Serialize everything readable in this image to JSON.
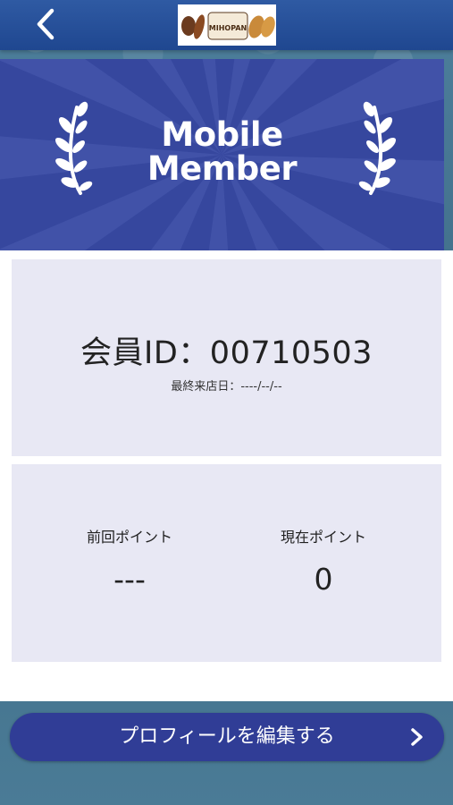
{
  "header": {
    "back_icon": "chevron-left-icon",
    "logo_icon": "store-logo-icon",
    "logo_text": "MIHOPAN"
  },
  "banner": {
    "title_line1": "Mobile",
    "title_line2": "Member",
    "decoration_icon": "laurel-icon"
  },
  "member": {
    "id_text": "会員ID：00710503",
    "last_visit": "最終来店日：----/--/--"
  },
  "points": {
    "previous_label": "前回ポイント",
    "previous_value": "---",
    "current_label": "現在ポイント",
    "current_value": "0"
  },
  "actions": {
    "edit_profile_label": "プロフィールを編集する",
    "edit_profile_icon": "chevron-right-icon"
  },
  "colors": {
    "header": "#2f5aa3",
    "banner": "#36479e",
    "card": "#e8e8f4",
    "button": "#303d96"
  }
}
